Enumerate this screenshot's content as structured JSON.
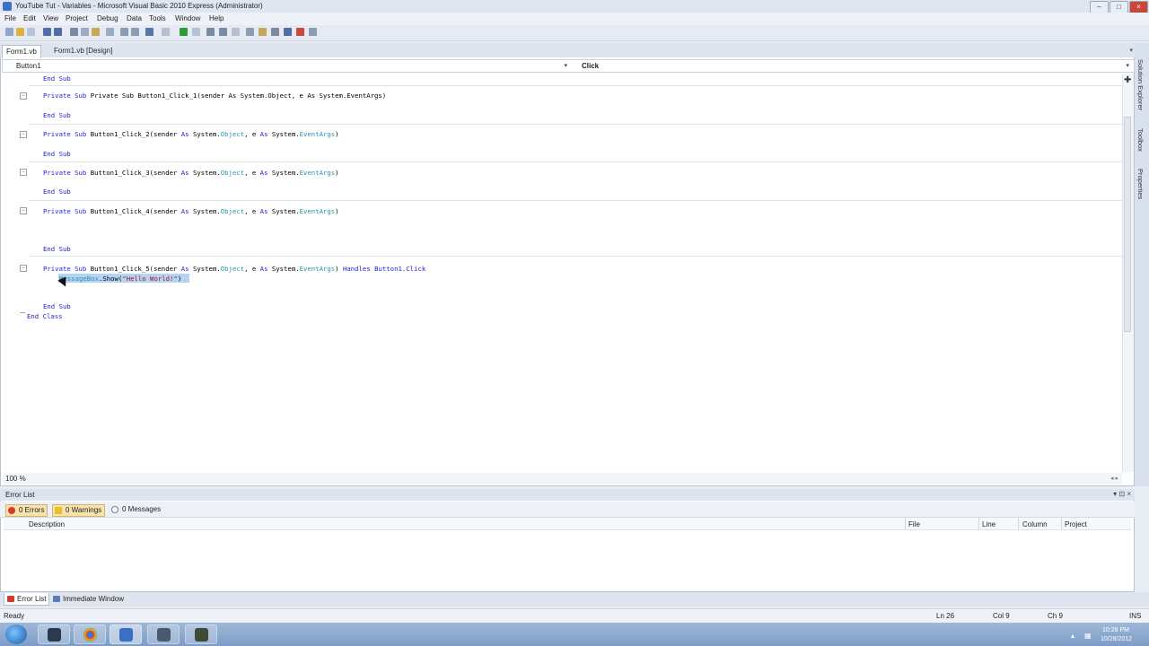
{
  "window": {
    "title": "YouTube Tut - Variables - Microsoft Visual Basic 2010 Express (Administrator)",
    "minimize": "–",
    "maximize": "□",
    "close": "×"
  },
  "menu": [
    "File",
    "Edit",
    "View",
    "Project",
    "Debug",
    "Data",
    "Tools",
    "Window",
    "Help"
  ],
  "tabs": {
    "active": "Form1.vb",
    "design": "Form1.vb [Design]"
  },
  "navbar": {
    "class_combo": "Button1",
    "method_combo": "Click"
  },
  "code": {
    "line1_end": "End Sub",
    "line2": [
      "Private",
      "Sub",
      "Button1_Click_1(sender",
      "As",
      "System.",
      "Object",
      ", e",
      "As",
      "System.",
      "EventArgs",
      ")"
    ],
    "click1": "Private Sub Button1_Click_1(sender As System.Object, e As System.EventArgs)",
    "end_sub": "End Sub",
    "click2": "Button1_Click_2",
    "click3": "Button1_Click_3",
    "click4": "Button1_Click_4",
    "click5": "Button1_Click_5",
    "handles": "Handles Button1.Click",
    "msgbox": "MessageBox",
    "show": ".Show(",
    "msgstr": "\"Hello World!\"",
    "close_paren": ")",
    "end_class": "End Class"
  },
  "zoom": "100 %",
  "side_panels": [
    "Solution Explorer",
    "Toolbox",
    "Properties"
  ],
  "error_list": {
    "title": "Error List",
    "errors": "0 Errors",
    "warnings": "0 Warnings",
    "messages": "0 Messages",
    "columns": [
      "Description",
      "File",
      "Line",
      "Column",
      "Project"
    ]
  },
  "bottom_tabs": [
    "Error List",
    "Immediate Window"
  ],
  "status": {
    "ready": "Ready",
    "ln": "Ln 26",
    "col": "Col 9",
    "ch": "Ch 9",
    "ins": "INS"
  },
  "clock": {
    "time": "10:28 PM",
    "date": "10/28/2012"
  }
}
